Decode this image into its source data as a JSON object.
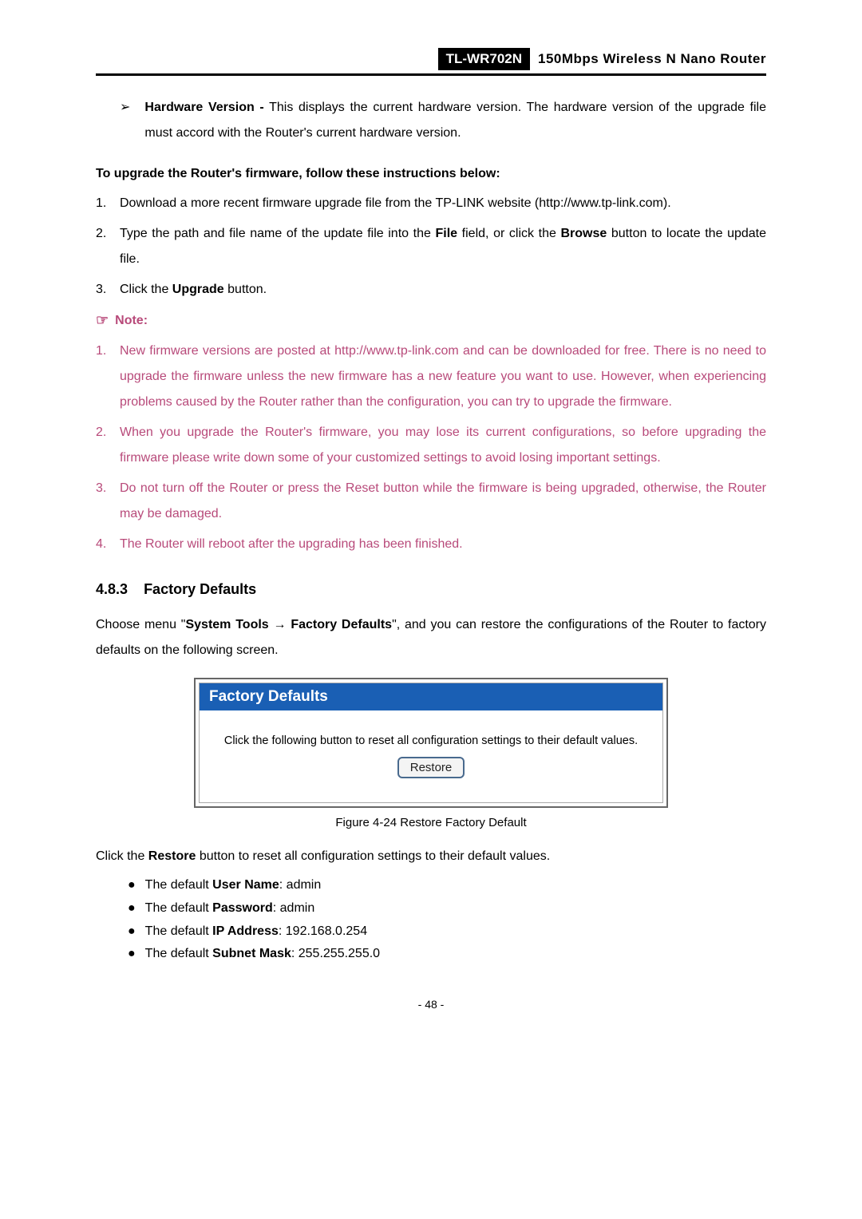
{
  "header": {
    "model": "TL-WR702N",
    "desc": "150Mbps  Wireless  N  Nano  Router"
  },
  "hw_bullet": {
    "label": "Hardware Version -",
    "text": " This displays the current hardware version. The hardware version of the upgrade file must accord with the Router's current hardware version."
  },
  "upgrade_intro": "To upgrade the Router's firmware, follow these instructions below:",
  "steps": [
    {
      "n": "1.",
      "pre": "Download   a   more   recent   firmware   upgrade   file   from   the   TP-LINK   website (",
      "link": "http://www.tp-link.com",
      "post": ")."
    },
    {
      "n": "2.",
      "pre": "Type the path and file name of the update file into the ",
      "b1": "File",
      "mid": " field, or click the ",
      "b2": "Browse",
      "post": " button to locate the update file."
    },
    {
      "n": "3.",
      "pre": "Click the ",
      "b1": "Upgrade",
      "post": " button."
    }
  ],
  "note_label": "Note:",
  "notes": [
    "New firmware versions are posted at http://www.tp-link.com and can be downloaded for free. There is no need to upgrade the firmware unless the new firmware has a new feature you want to use. However, when experiencing problems caused by the Router rather than the configuration, you can try to upgrade the firmware.",
    "When you upgrade the Router's firmware, you may lose its current configurations, so before upgrading the firmware please write down some of your customized settings to avoid losing important settings.",
    "Do not turn off the Router or press the Reset button while the firmware is being upgraded, otherwise, the Router may be damaged.",
    "The Router will reboot after the upgrading has been finished."
  ],
  "section": {
    "num": "4.8.3",
    "title": "Factory Defaults"
  },
  "factory_intro": {
    "pre": "Choose menu \"",
    "b1": "System Tools",
    "arrow": "  →  ",
    "b2": "Factory Defaults",
    "post": "\", and you can restore the configurations of the Router to factory defaults on the following screen."
  },
  "screenshot": {
    "title": "Factory Defaults",
    "body": "Click the following button to reset all configuration settings to their default values.",
    "button": "Restore"
  },
  "figure_caption": "Figure 4-24 Restore Factory Default",
  "after_fig": {
    "pre": "Click the ",
    "b1": "Restore",
    "post": " button to reset all configuration settings to their default values."
  },
  "defaults": [
    {
      "label": "User Name",
      "pre": "The default ",
      "val": ": admin"
    },
    {
      "label": "Password",
      "pre": "The default ",
      "val": ": admin"
    },
    {
      "label": "IP Address",
      "pre": "The default ",
      "val": ": 192.168.0.254"
    },
    {
      "label": "Subnet Mask",
      "pre": "The default ",
      "val": ": 255.255.255.0"
    }
  ],
  "page_number": "- 48 -"
}
